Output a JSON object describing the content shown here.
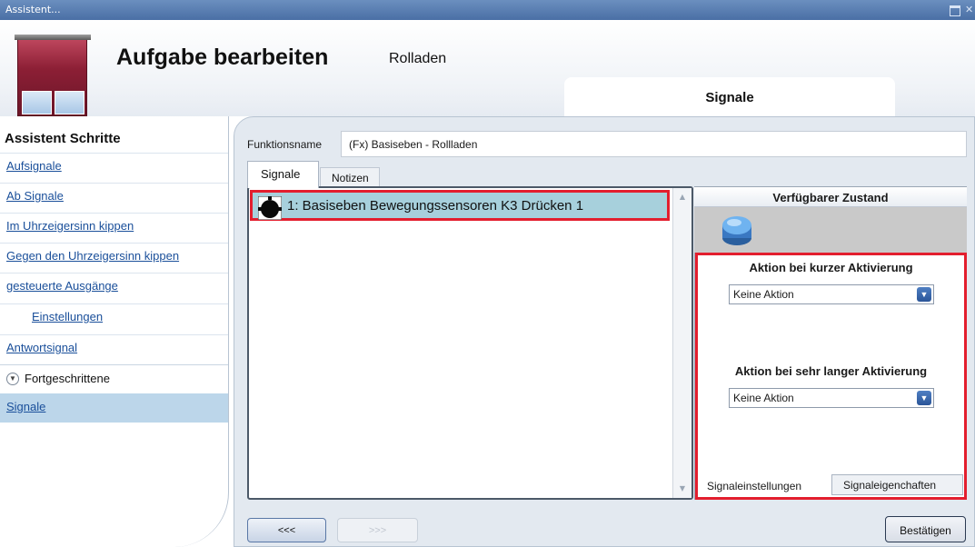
{
  "window": {
    "title": "Assistent..."
  },
  "header": {
    "title": "Aufgabe bearbeiten",
    "subtitle": "Rolladen",
    "section_tab": "Signale"
  },
  "sidebar": {
    "heading": "Assistent Schritte",
    "steps": [
      {
        "label": "Aufsignale"
      },
      {
        "label": "Ab Signale"
      },
      {
        "label": "Im Uhrzeigersinn kippen"
      },
      {
        "label": "Gegen den Uhrzeigersinn kippen"
      },
      {
        "label": "gesteuerte Ausgänge"
      },
      {
        "label": "Einstellungen"
      },
      {
        "label": "Antwortsignal"
      }
    ],
    "advanced_label": "Fortgeschrittene",
    "active_step": "Signale"
  },
  "form": {
    "function_name_label": "Funktionsname",
    "function_name_value": "(Fx) Basiseben - Rollladen"
  },
  "tabs": [
    "Signale",
    "Notizen"
  ],
  "signals": [
    {
      "label": "1: Basiseben Bewegungssensoren K3 Drücken 1"
    }
  ],
  "right_panel": {
    "state_header": "Verfügbarer Zustand",
    "short_action_label": "Aktion bei kurzer Aktivierung",
    "short_action_value": "Keine Aktion",
    "long_action_label": "Aktion bei sehr langer Aktivierung",
    "long_action_value": "Keine Aktion",
    "subtabs": [
      "Signaleinstellungen",
      "Signaleigenchaften"
    ]
  },
  "footer": {
    "back_label": "<<<",
    "next_label": ">>>",
    "confirm_label": "Bestätigen"
  },
  "colors": {
    "highlight_border": "#e31e2e",
    "selected_row": "#a7d0dc",
    "titlebar": "#4a6fa5",
    "link": "#1a4f9a"
  }
}
